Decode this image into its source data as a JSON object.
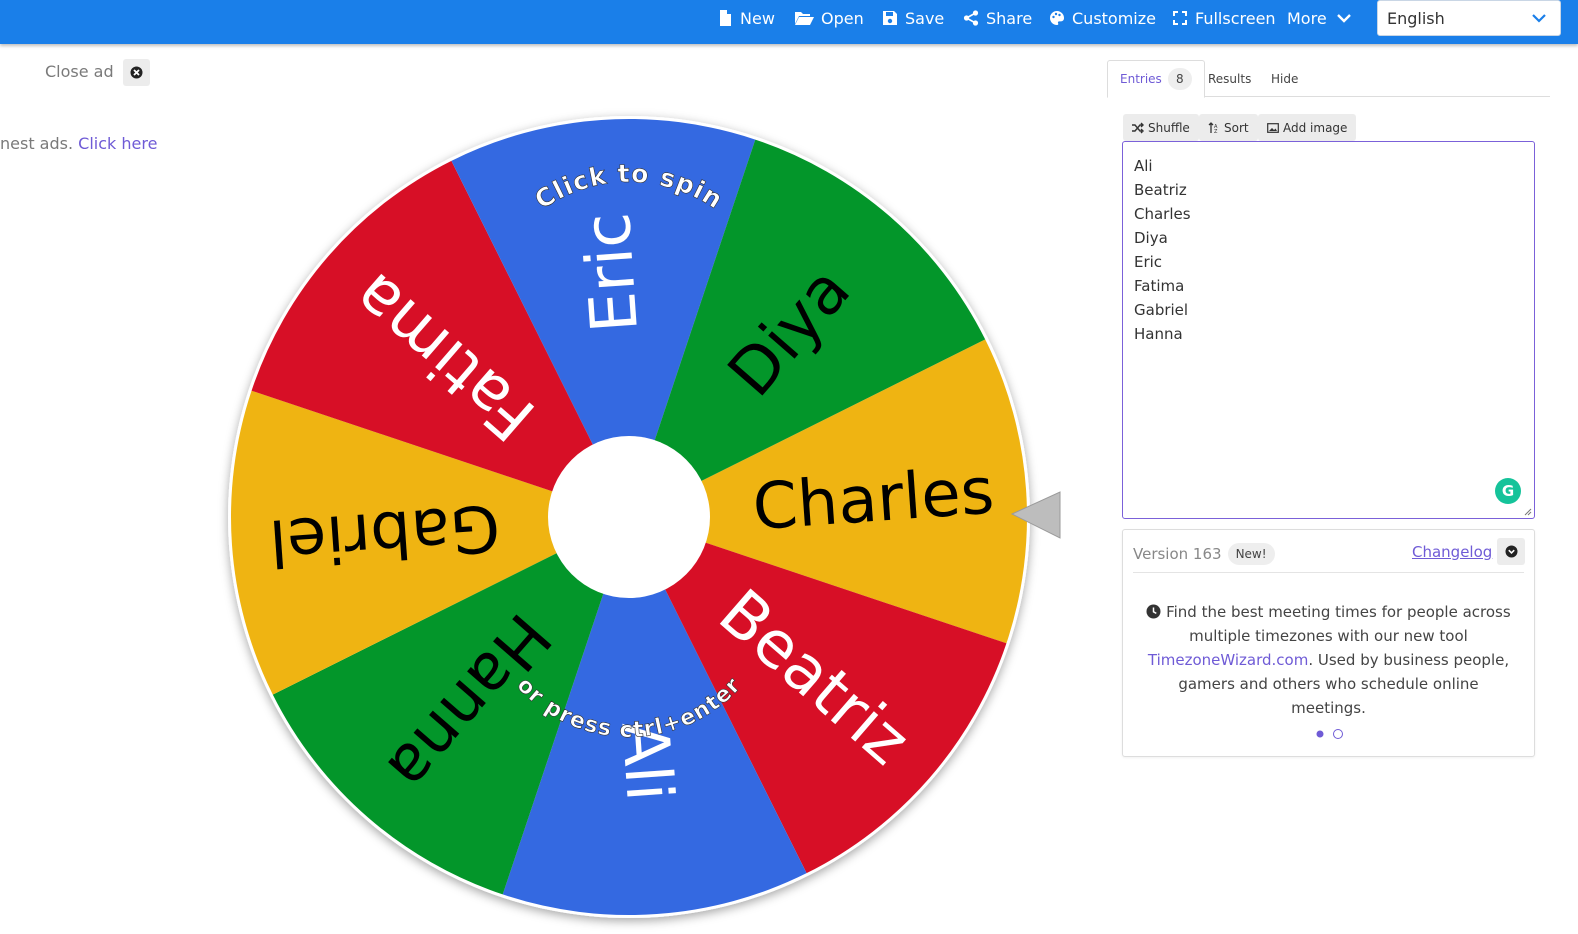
{
  "toolbar": {
    "new_label": "New",
    "open_label": "Open",
    "save_label": "Save",
    "share_label": "Share",
    "customize_label": "Customize",
    "fullscreen_label": "Fullscreen",
    "more_label": "More",
    "language": "English",
    "bar_color": "#1a7fe9"
  },
  "ad": {
    "close_label": "Close ad",
    "text_fragment": "nest ads.",
    "link_label": "Click here"
  },
  "wheel": {
    "slices": [
      {
        "label": "Charles",
        "color": "#efb412",
        "text_color": "#000000"
      },
      {
        "label": "Beatriz",
        "color": "#d70f26",
        "text_color": "#ffffff"
      },
      {
        "label": "Ali",
        "color": "#3469e1",
        "text_color": "#ffffff"
      },
      {
        "label": "Hanna",
        "color": "#03962a",
        "text_color": "#000000"
      },
      {
        "label": "Gabriel",
        "color": "#efb412",
        "text_color": "#000000"
      },
      {
        "label": "Fatima",
        "color": "#d70f26",
        "text_color": "#ffffff"
      },
      {
        "label": "Eric",
        "color": "#3469e1",
        "text_color": "#ffffff"
      },
      {
        "label": "Diya",
        "color": "#03962a",
        "text_color": "#000000"
      }
    ],
    "click_text": "Click to spin",
    "press_text": "or press ctrl+enter"
  },
  "tabs": {
    "entries_label": "Entries",
    "entries_count": "8",
    "results_label": "Results",
    "hide_label": "Hide"
  },
  "tools": {
    "shuffle_label": "Shuffle",
    "sort_label": "Sort",
    "add_image_label": "Add image"
  },
  "entries": [
    "Ali",
    "Beatriz",
    "Charles",
    "Diya",
    "Eric",
    "Fatima",
    "Gabriel",
    "Hanna"
  ],
  "info": {
    "version_label": "Version 163",
    "new_badge": "New!",
    "changelog_label": "Changelog",
    "body_pre": "Find the best meeting times for people across multiple timezones with our new tool",
    "body_link": "TimezoneWizard.com",
    "body_post": ". Used by business people, gamers and others who schedule online meetings."
  },
  "accent_color": "#6f5bd6"
}
